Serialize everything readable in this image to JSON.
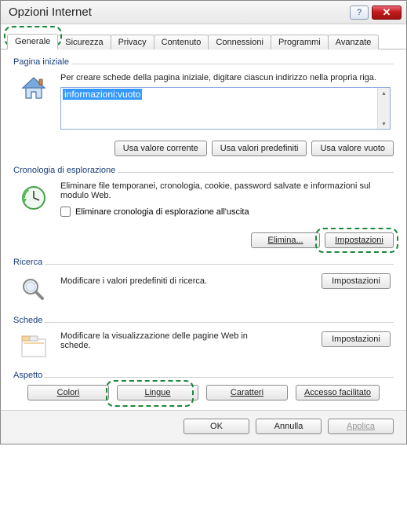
{
  "window": {
    "title": "Opzioni Internet"
  },
  "tabs": {
    "general": "Generale",
    "security": "Sicurezza",
    "privacy": "Privacy",
    "content": "Contenuto",
    "connections": "Connessioni",
    "programs": "Programmi",
    "advanced": "Avanzate"
  },
  "homepage": {
    "legend": "Pagina iniziale",
    "instruction": "Per creare schede della pagina iniziale, digitare ciascun indirizzo nella propria riga.",
    "value": "informazioni:vuoto",
    "use_current": "Usa valore corrente",
    "use_default": "Usa valori predefiniti",
    "use_blank": "Usa valore vuoto"
  },
  "history": {
    "legend": "Cronologia di esplorazione",
    "instruction": "Eliminare file temporanei, cronologia, cookie, password salvate e informazioni sul modulo Web.",
    "delete_on_exit": "Eliminare cronologia di esplorazione all'uscita",
    "delete": "Elimina...",
    "settings": "Impostazioni"
  },
  "search": {
    "legend": "Ricerca",
    "instruction": "Modificare i valori predefiniti di ricerca.",
    "settings": "Impostazioni"
  },
  "tabs_section": {
    "legend": "Schede",
    "instruction": "Modificare la visualizzazione delle pagine Web in schede.",
    "settings": "Impostazioni"
  },
  "appearance": {
    "legend": "Aspetto",
    "colors": "Colori",
    "languages": "Lingue",
    "fonts": "Caratteri",
    "accessibility": "Accesso facilitato"
  },
  "footer": {
    "ok": "OK",
    "cancel": "Annulla",
    "apply": "Applica"
  }
}
